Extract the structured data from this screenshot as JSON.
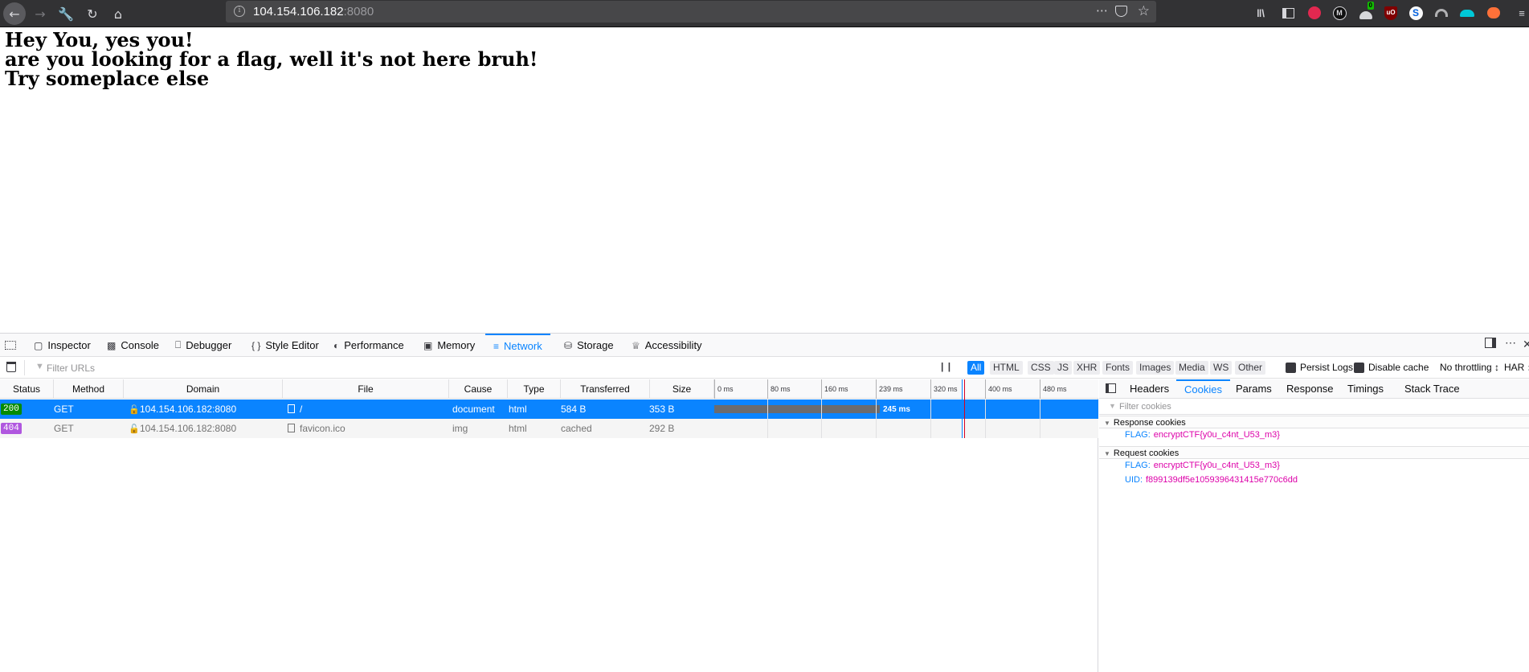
{
  "browser": {
    "url_host": "104.154.106.182",
    "url_port": ":8080",
    "icons": {
      "back": "arrow-left-icon",
      "forward": "arrow-right-icon",
      "tools": "wrench-icon",
      "reload": "reload-icon",
      "home": "home-icon",
      "info": "info-icon",
      "page_actions": "more-icon",
      "pocket": "pocket-icon",
      "bookmark": "star-icon"
    },
    "extension_badge": "0"
  },
  "page": {
    "lines": [
      "Hey You, yes you!",
      "are you looking for a flag, well it's not here bruh!",
      "Try someplace else"
    ]
  },
  "devtools": {
    "tabs": [
      {
        "label": "Inspector",
        "icon": "inspector-icon"
      },
      {
        "label": "Console",
        "icon": "console-icon"
      },
      {
        "label": "Debugger",
        "icon": "debugger-icon"
      },
      {
        "label": "Style Editor",
        "icon": "style-editor-icon"
      },
      {
        "label": "Performance",
        "icon": "performance-icon"
      },
      {
        "label": "Memory",
        "icon": "memory-icon"
      },
      {
        "label": "Network",
        "icon": "network-icon"
      },
      {
        "label": "Storage",
        "icon": "storage-icon"
      },
      {
        "label": "Accessibility",
        "icon": "accessibility-icon"
      }
    ],
    "selected_tab": "Network",
    "filter_placeholder": "Filter URLs",
    "type_filters": [
      "All",
      "HTML",
      "CSS",
      "JS",
      "XHR",
      "Fonts",
      "Images",
      "Media",
      "WS",
      "Other"
    ],
    "selected_type_filter": "All",
    "persist_logs_label": "Persist Logs",
    "disable_cache_label": "Disable cache",
    "throttling_label": "No throttling ↕",
    "har_label": "HAR ↕",
    "columns": {
      "status": "Status",
      "method": "Method",
      "domain": "Domain",
      "file": "File",
      "cause": "Cause",
      "type": "Type",
      "transferred": "Transferred",
      "size": "Size"
    },
    "waterfall_ticks": [
      "0 ms",
      "80 ms",
      "160 ms",
      "239 ms",
      "320 ms",
      "400 ms",
      "480 ms"
    ],
    "requests": [
      {
        "status": "200",
        "method": "GET",
        "domain": "104.154.106.182:8080",
        "file": "/",
        "cause": "document",
        "type": "html",
        "transferred": "584 B",
        "size": "353 B",
        "timing": "245 ms",
        "selected": true,
        "timing_ms": 245
      },
      {
        "status": "404",
        "method": "GET",
        "domain": "104.154.106.182:8080",
        "file": "favicon.ico",
        "cause": "img",
        "type": "html",
        "transferred": "cached",
        "size": "292 B",
        "selected": false
      }
    ],
    "details": {
      "tabs": [
        "Headers",
        "Cookies",
        "Params",
        "Response",
        "Timings",
        "Stack Trace"
      ],
      "selected": "Cookies",
      "filter_placeholder": "Filter cookies",
      "response_cookies_label": "Response cookies",
      "request_cookies_label": "Request cookies",
      "response_cookies": [
        {
          "name": "FLAG:",
          "value": "encryptCTF{y0u_c4nt_U53_m3}"
        }
      ],
      "request_cookies": [
        {
          "name": "FLAG:",
          "value": "encryptCTF{y0u_c4nt_U53_m3}"
        },
        {
          "name": "UID:",
          "value": "f899139df5e1059396431415e770c6dd"
        }
      ]
    },
    "colors": {
      "accent": "#0a84ff",
      "status_200": "#058b00",
      "status_404": "#b057df",
      "cookie_value": "#dd00a9"
    }
  }
}
